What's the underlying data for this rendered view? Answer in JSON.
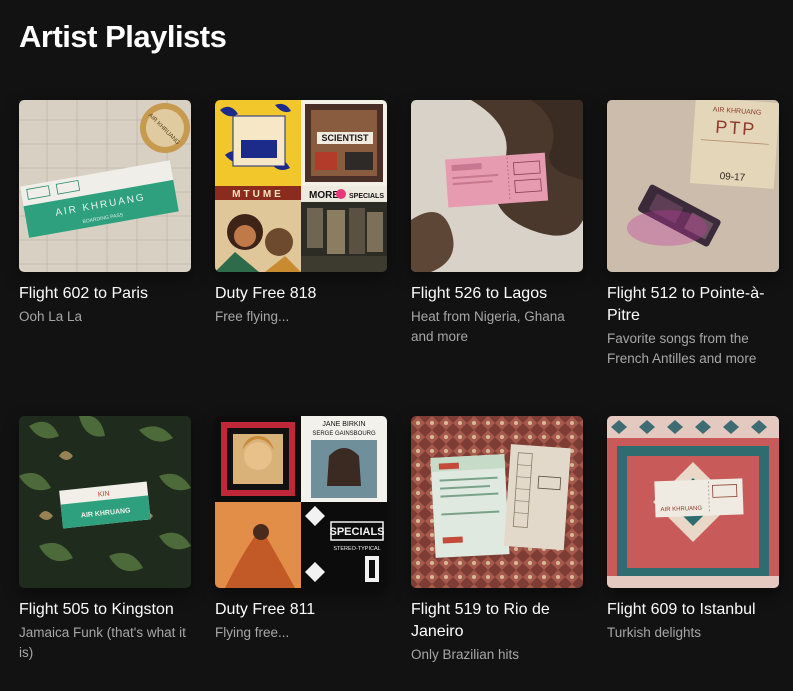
{
  "section": {
    "title": "Artist Playlists"
  },
  "playlists": [
    {
      "title": "Flight 602 to Paris",
      "subtitle": "Ooh La La"
    },
    {
      "title": "Duty Free 818",
      "subtitle": "Free flying..."
    },
    {
      "title": "Flight 526 to Lagos",
      "subtitle": "Heat from Nigeria, Ghana and more"
    },
    {
      "title": "Flight 512 to Pointe-à-Pitre",
      "subtitle": "Favorite songs from the French Antilles and more"
    },
    {
      "title": "Flight 505 to Kingston",
      "subtitle": "Jamaica Funk (that's what it is)"
    },
    {
      "title": "Duty Free 811",
      "subtitle": "Flying free..."
    },
    {
      "title": "Flight 519 to Rio de Janeiro",
      "subtitle": "Only Brazilian hits"
    },
    {
      "title": "Flight 609 to Istanbul",
      "subtitle": "Turkish delights"
    }
  ],
  "cover_text": {
    "paris_ticket": "AIR KHRUANG",
    "paris_pass": "BOARDING PASS",
    "paris_seal": "AIR KHRUANG",
    "duty818_a": "SCIENTIST",
    "duty818_b": "MTUME",
    "duty818_c": "SPECIALS",
    "duty818_d": "MORE",
    "ptp_brand": "AIR KHRUANG",
    "ptp_code": "PTP",
    "ptp_date": "09-17",
    "kingston_brand": "AIR KHRUANG",
    "kingston_code": "KIN",
    "duty811_a": "JANE BIRKIN",
    "duty811_b": "SERGE GAINSBOURG",
    "duty811_c": "SPECIALS",
    "duty811_d": "STEREO-TYPICAL",
    "istanbul_brand": "AIR KHRUANG"
  },
  "colors": {
    "background": "#121212",
    "title": "#ffffff",
    "subtitle": "#a7a7a7"
  }
}
